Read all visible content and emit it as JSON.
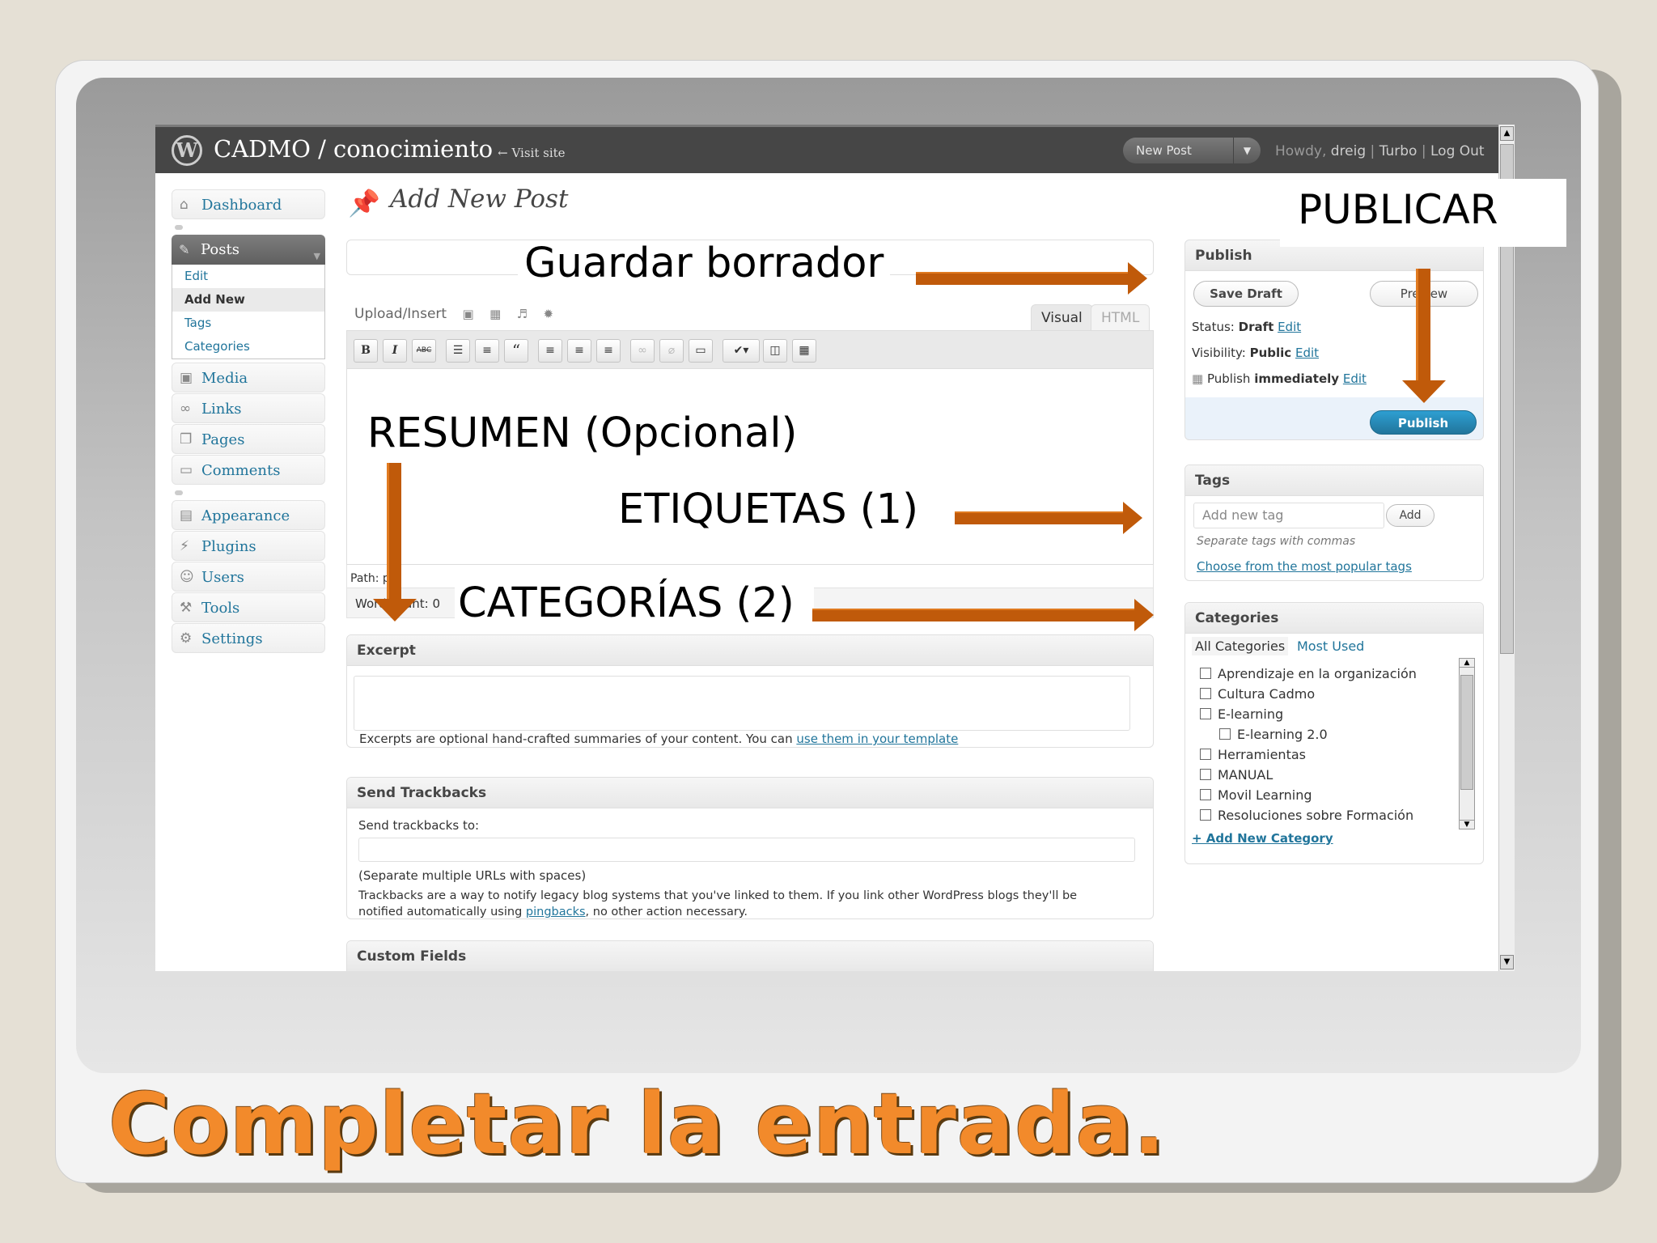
{
  "slide": {
    "caption": "Completar la entrada."
  },
  "annotations": {
    "guardar": "Guardar borrador",
    "publicar": "PUBLICAR",
    "resumen": "RESUMEN (Opcional)",
    "etiquetas": "ETIQUETAS (1)",
    "categorias": "CATEGORÍAS (2)"
  },
  "header": {
    "site": "CADMO / conocimiento",
    "visit": "← Visit site",
    "new_post": "New Post",
    "howdy_prefix": "Howdy, ",
    "user": "dreig",
    "turbo": "Turbo",
    "logout": "Log Out"
  },
  "menu": {
    "dashboard": "Dashboard",
    "posts": "Posts",
    "posts_sub": [
      "Edit",
      "Add New",
      "Tags",
      "Categories"
    ],
    "media": "Media",
    "links": "Links",
    "pages": "Pages",
    "comments": "Comments",
    "appearance": "Appearance",
    "plugins": "Plugins",
    "users": "Users",
    "tools": "Tools",
    "settings": "Settings"
  },
  "editor": {
    "page_title": "Add New Post",
    "upload_insert": "Upload/Insert",
    "tab_visual": "Visual",
    "tab_html": "HTML",
    "path": "Path: p",
    "word_count": "Word count: 0"
  },
  "excerpt": {
    "title": "Excerpt",
    "help": "Excerpts are optional hand-crafted summaries of your content. You can ",
    "help_link": "use them in your template"
  },
  "trackbacks": {
    "title": "Send Trackbacks",
    "label": "Send trackbacks to:",
    "hint": "(Separate multiple URLs with spaces)",
    "desc1": "Trackbacks are a way to notify legacy blog systems that you've linked to them. If you link other WordPress blogs they'll be",
    "desc2_pre": "notified automatically using ",
    "desc2_link": "pingbacks",
    "desc2_post": ", no other action necessary."
  },
  "custom_fields": {
    "title": "Custom Fields"
  },
  "publish": {
    "title": "Publish",
    "save_draft": "Save Draft",
    "preview": "Preview",
    "status_label": "Status: ",
    "status_value": "Draft",
    "visibility_label": "Visibility: ",
    "visibility_value": "Public",
    "publish_label": "Publish ",
    "publish_value": "immediately",
    "edit": "Edit",
    "publish_button": "Publish"
  },
  "tags": {
    "title": "Tags",
    "placeholder": "Add new tag",
    "add": "Add",
    "hint": "Separate tags with commas",
    "popular": "Choose from the most popular tags"
  },
  "categories": {
    "title": "Categories",
    "tab_all": "All Categories",
    "tab_most": "Most Used",
    "items": [
      "Aprendizaje en la organización",
      "Cultura Cadmo",
      "E-learning",
      "E-learning 2.0",
      "Herramientas",
      "MANUAL",
      "Movil Learning",
      "Resoluciones sobre Formación"
    ],
    "add_new": "+ Add New Category"
  },
  "colors": {
    "accent": "#21759b",
    "arrow": "#c05a0a",
    "caption": "#f28a2b"
  }
}
